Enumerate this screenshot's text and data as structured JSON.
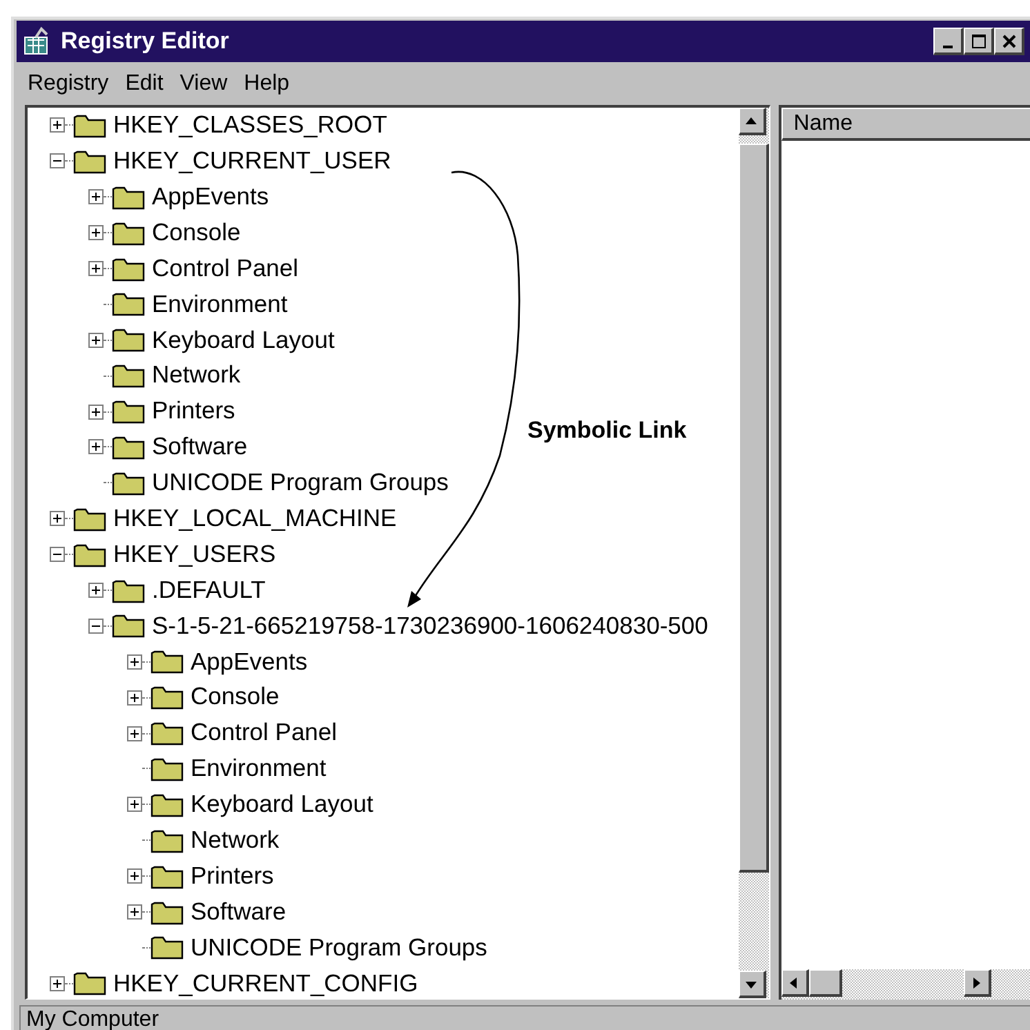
{
  "window": {
    "title": "Registry Editor"
  },
  "menu": [
    "Registry",
    "Edit",
    "View",
    "Help"
  ],
  "tree": [
    {
      "label": "HKEY_CLASSES_ROOT",
      "kind": "branch",
      "expanded": false
    },
    {
      "label": "HKEY_CURRENT_USER",
      "kind": "branch",
      "expanded": true,
      "children": [
        {
          "label": "AppEvents",
          "kind": "branch",
          "expanded": false
        },
        {
          "label": "Console",
          "kind": "branch",
          "expanded": false
        },
        {
          "label": "Control Panel",
          "kind": "branch",
          "expanded": false
        },
        {
          "label": "Environment",
          "kind": "leaf"
        },
        {
          "label": "Keyboard Layout",
          "kind": "branch",
          "expanded": false
        },
        {
          "label": "Network",
          "kind": "leaf"
        },
        {
          "label": "Printers",
          "kind": "branch",
          "expanded": false
        },
        {
          "label": "Software",
          "kind": "branch",
          "expanded": false
        },
        {
          "label": "UNICODE Program Groups",
          "kind": "leaf"
        }
      ]
    },
    {
      "label": "HKEY_LOCAL_MACHINE",
      "kind": "branch",
      "expanded": false
    },
    {
      "label": "HKEY_USERS",
      "kind": "branch",
      "expanded": true,
      "children": [
        {
          "label": ".DEFAULT",
          "kind": "branch",
          "expanded": false
        },
        {
          "label": "S-1-5-21-665219758-1730236900-1606240830-500",
          "kind": "branch",
          "expanded": true,
          "children": [
            {
              "label": "AppEvents",
              "kind": "branch",
              "expanded": false
            },
            {
              "label": "Console",
              "kind": "branch",
              "expanded": false
            },
            {
              "label": "Control Panel",
              "kind": "branch",
              "expanded": false
            },
            {
              "label": "Environment",
              "kind": "leaf"
            },
            {
              "label": "Keyboard Layout",
              "kind": "branch",
              "expanded": false
            },
            {
              "label": "Network",
              "kind": "leaf"
            },
            {
              "label": "Printers",
              "kind": "branch",
              "expanded": false
            },
            {
              "label": "Software",
              "kind": "branch",
              "expanded": false
            },
            {
              "label": "UNICODE Program Groups",
              "kind": "leaf"
            }
          ]
        }
      ]
    },
    {
      "label": "HKEY_CURRENT_CONFIG",
      "kind": "branch",
      "expanded": false
    }
  ],
  "annotation": {
    "label": "Symbolic Link"
  },
  "list_header": {
    "column_1": "Name"
  },
  "status_bar": "My Computer"
}
